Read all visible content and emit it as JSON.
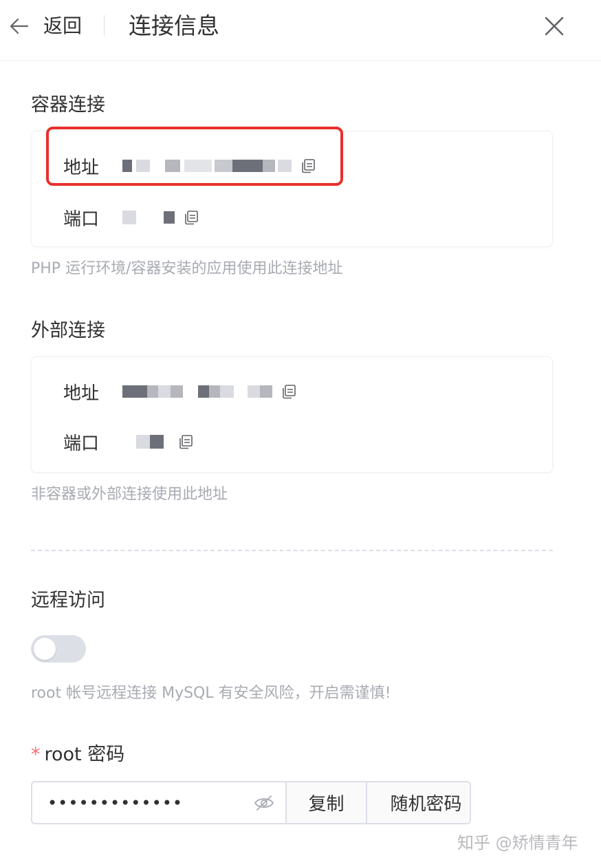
{
  "header": {
    "back_label": "返回",
    "title": "连接信息"
  },
  "container_connection": {
    "title": "容器连接",
    "address_label": "地址",
    "port_label": "端口",
    "hint": "PHP 运行环境/容器安装的应用使用此连接地址"
  },
  "external_connection": {
    "title": "外部连接",
    "address_label": "地址",
    "port_label": "端口",
    "hint": "非容器或外部连接使用此地址"
  },
  "remote_access": {
    "title": "远程访问",
    "enabled": false,
    "hint": "root 帐号远程连接 MySQL 有安全风险，开启需谨慎!"
  },
  "password": {
    "required_mark": "*",
    "label": "root 密码",
    "value": "•••••••••••••",
    "copy_label": "复制",
    "random_label": "随机密码"
  },
  "watermark": "知乎 @矫情青年",
  "colors": {
    "highlight": "#e8302b",
    "required": "#f56c6c",
    "hint": "#a8abb2",
    "switch_off": "#dcdfe6"
  }
}
